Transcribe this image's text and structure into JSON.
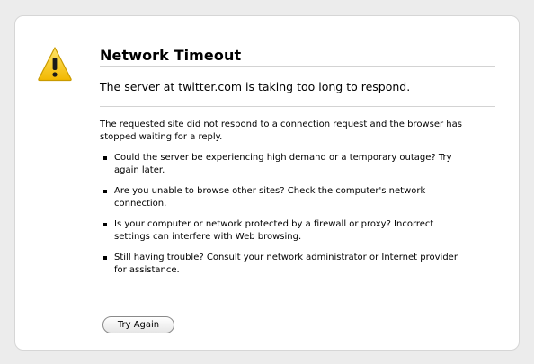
{
  "error": {
    "title": "Network Timeout",
    "short_desc": "The server at twitter.com is taking too long to respond.",
    "long_desc": "The requested site did not respond to a connection request and the browser has stopped waiting for a reply.",
    "suggestions": [
      "Could the server be experiencing high demand or a temporary outage? Try again later.",
      "Are you unable to browse other sites? Check the computer's network connection.",
      "Is your computer or network protected by a firewall or proxy? Incorrect settings can interfere with Web browsing.",
      "Still having trouble? Consult your network administrator or Internet provider for assistance."
    ],
    "icon": "warning-icon"
  },
  "actions": {
    "try_again_label": "Try Again"
  },
  "colors": {
    "icon_fill": "#f5c81e",
    "icon_stroke": "#c99a00",
    "background": "#ececec",
    "panel": "#ffffff"
  }
}
